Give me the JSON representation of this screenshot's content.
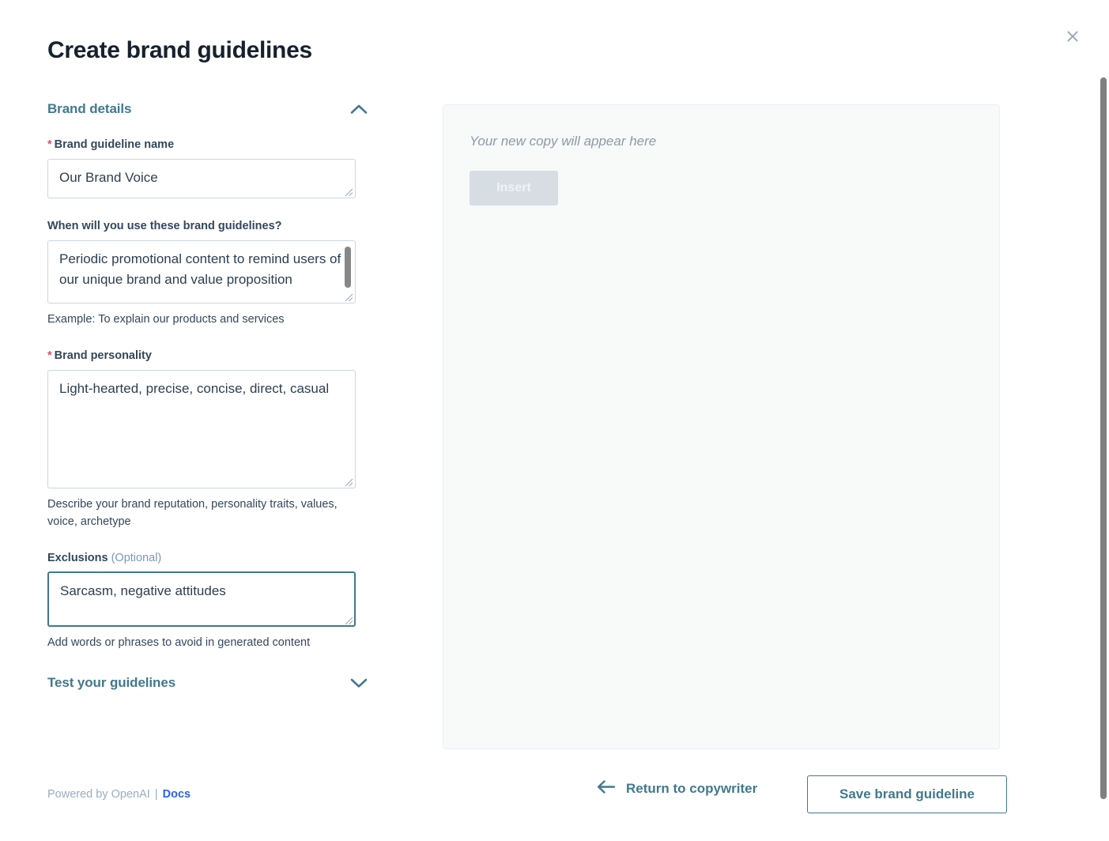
{
  "header": {
    "title": "Create brand guidelines",
    "close_icon": "close-icon"
  },
  "colors": {
    "accent_teal": "#41798D",
    "required_star": "#D94F70",
    "docs_link_blue": "#2D62E8",
    "title_dark": "#16212D",
    "label_slate": "#33475B",
    "panel_bg": "#F8FAFA",
    "disabled_button": "#D6DDE3"
  },
  "sections": {
    "brand_details": {
      "title": "Brand details",
      "expanded": true,
      "chevron_icon": "chevron-up-icon"
    },
    "test_guidelines": {
      "title": "Test your guidelines",
      "expanded": false,
      "chevron_icon": "chevron-down-icon"
    }
  },
  "fields": {
    "guideline_name": {
      "label": "Brand guideline name",
      "required": true,
      "required_marker": "*",
      "value": "Our Brand Voice",
      "placeholder": "",
      "help": ""
    },
    "when_use": {
      "label": "When will you use these brand guidelines?",
      "required": false,
      "value": "Periodic promotional content to remind users of our unique brand and value proposition",
      "placeholder": "",
      "help": "Example: To explain our products and services",
      "has_scrollbar": true
    },
    "brand_personality": {
      "label": "Brand personality",
      "required": true,
      "required_marker": "*",
      "value": "Light-hearted, precise, concise, direct, casual",
      "placeholder": "",
      "help": "Describe your brand reputation, personality traits, values, voice, archetype"
    },
    "exclusions": {
      "label": "Exclusions",
      "optional_suffix": "(Optional)",
      "required": false,
      "value": "Sarcasm, negative attitudes",
      "placeholder": "",
      "help": "Add words or phrases to avoid in generated content",
      "focused": true
    }
  },
  "preview": {
    "placeholder": "Your new copy will appear here",
    "insert_label": "Insert",
    "insert_disabled": true
  },
  "footer": {
    "powered_by": "Powered by OpenAI",
    "separator": "|",
    "docs_label": "Docs",
    "return_label": "Return to copywriter",
    "return_icon": "arrow-left-icon",
    "save_label": "Save brand guideline"
  }
}
